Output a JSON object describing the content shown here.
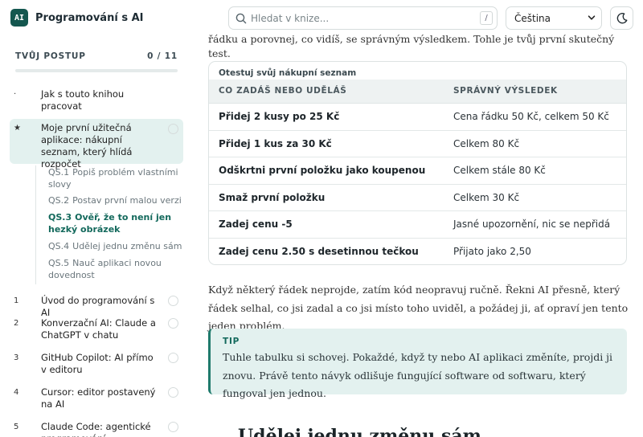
{
  "app": {
    "logo": "AI",
    "title": "Programování s AI"
  },
  "progress": {
    "label": "TVŮJ POSTUP",
    "count": "0 / 11",
    "fraction": 0.0
  },
  "search": {
    "placeholder": "Hledat v knize...",
    "shortcut": "/"
  },
  "language": {
    "selected": "Čeština"
  },
  "nav": {
    "items": [
      {
        "num": "·",
        "label": "Jak s touto knihou pracovat"
      },
      {
        "num": "★",
        "label": "Moje první užitečná aplikace: nákupní seznam, který hlídá rozpočet"
      },
      {
        "num": "1",
        "label": "Úvod do programování s AI"
      },
      {
        "num": "2",
        "label": "Konverzační AI: Claude a ChatGPT v chatu"
      },
      {
        "num": "3",
        "label": "GitHub Copilot: AI přímo v editoru"
      },
      {
        "num": "4",
        "label": "Cursor: editor postavený na AI"
      },
      {
        "num": "5",
        "label": "Claude Code: agentické programování"
      }
    ],
    "subitems": [
      {
        "id": "QS.1",
        "label": "Popiš problém vlastními slovy"
      },
      {
        "id": "QS.2",
        "label": "Postav první malou verzi"
      },
      {
        "id": "QS.3",
        "label": "Ověř, že to není jen hezký obrázek"
      },
      {
        "id": "QS.4",
        "label": "Udělej jednu změnu sám"
      },
      {
        "id": "QS.5",
        "label": "Nauč aplikaci novou dovednost"
      }
    ]
  },
  "content": {
    "lead": "řádku a porovnej, co vidíš, se správným výsledkem. Tohle je tvůj první skutečný test.",
    "table": {
      "caption": "Otestuj svůj nákupní seznam",
      "headers": [
        "CO ZADÁŠ NEBO UDĚLÁŠ",
        "SPRÁVNÝ VÝSLEDEK"
      ],
      "rows": [
        [
          "Přidej 2 kusy po 25 Kč",
          "Cena řádku 50 Kč, celkem 50 Kč"
        ],
        [
          "Přidej 1 kus za 30 Kč",
          "Celkem 80 Kč"
        ],
        [
          "Odškrtni první položku jako koupenou",
          "Celkem stále 80 Kč"
        ],
        [
          "Smaž první položku",
          "Celkem 30 Kč"
        ],
        [
          "Zadej cenu -5",
          "Jasné upozornění, nic se nepřidá"
        ],
        [
          "Zadej cenu 2.50 s desetinnou tečkou",
          "Přijato jako 2,50"
        ]
      ]
    },
    "paragraph": "Když některý řádek neprojde, zatím kód neopravuj ručně. Řekni AI přesně, který řádek selhal, co jsi zadal a co jsi místo toho uviděl, a požádej ji, ať opraví jen tento jeden problém.",
    "tip": {
      "title": "TIP",
      "text": "Tuhle tabulku si schovej. Pokaždé, když ty nebo AI aplikaci změníte, projdi ji znovu. Právě tento návyk odlišuje fungující software od softwaru, který fungoval jen jednou."
    },
    "next_heading": "Udělej jednu změnu sám"
  },
  "colors": {
    "accent": "#1f7a6c",
    "accent_bg": "#e3f1ef",
    "logo_bg": "#14574f"
  },
  "icons": {
    "search": "search-icon",
    "theme": "moon-icon",
    "language": "chevron-down-icon"
  }
}
